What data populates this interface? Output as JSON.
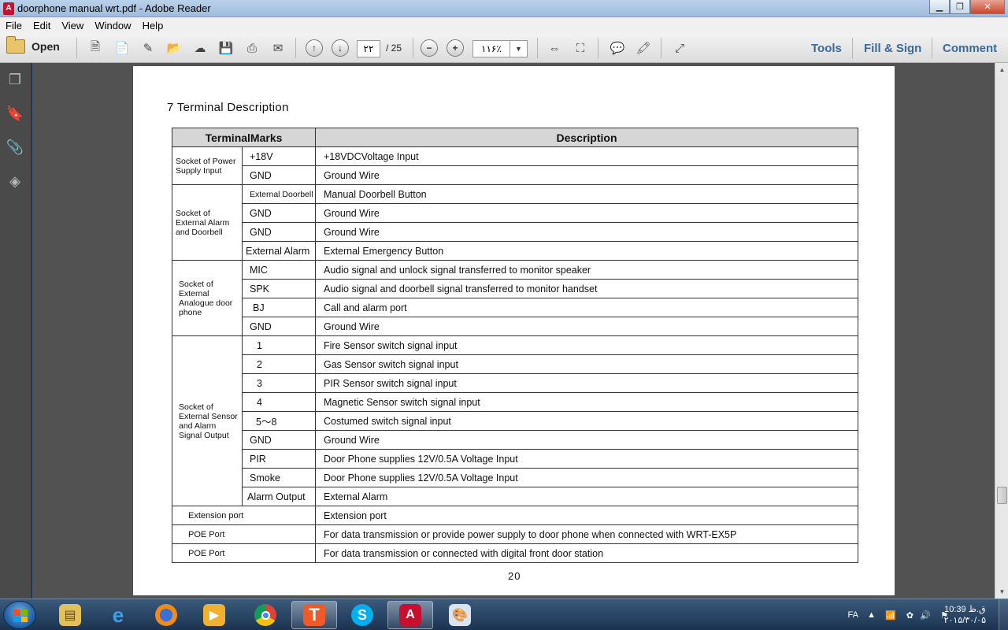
{
  "window": {
    "title": "doorphone manual wrt.pdf - Adobe Reader",
    "app_icon_glyph": "A"
  },
  "menu": [
    "File",
    "Edit",
    "View",
    "Window",
    "Help"
  ],
  "toolbar": {
    "open_label": "Open",
    "page_current": "۲۲",
    "page_total": "/ 25",
    "zoom": "۱۱۶٪",
    "tools_label": "Tools",
    "fill_sign_label": "Fill & Sign",
    "comment_label": "Comment"
  },
  "document": {
    "heading": "7 Terminal Description",
    "page_number": "20",
    "table": {
      "headers": [
        "TerminalMarks",
        "Description"
      ],
      "rows": [
        {
          "group": "Socket of Power Supply Input",
          "mark": "+18V",
          "desc": "+18VDCVoltage Input"
        },
        {
          "mark": "GND",
          "desc": "Ground Wire"
        },
        {
          "group": "Socket of External Alarm and Doorbell",
          "mark": "External Doorbell",
          "desc": "Manual Doorbell Button"
        },
        {
          "mark": "GND",
          "desc": "Ground Wire"
        },
        {
          "mark": "GND",
          "desc": "Ground Wire"
        },
        {
          "mark": "External Alarm",
          "desc": "External Emergency Button"
        },
        {
          "group": "Socket of External Analogue door phone",
          "mark": "MIC",
          "desc": "Audio signal and unlock signal transferred to monitor speaker"
        },
        {
          "mark": "SPK",
          "desc": "Audio signal and doorbell signal transferred to monitor handset"
        },
        {
          "mark": "BJ",
          "desc": "Call and alarm port"
        },
        {
          "mark": "GND",
          "desc": "Ground Wire"
        },
        {
          "group": "Socket of External Sensor and Alarm Signal Output",
          "mark": "1",
          "desc": "Fire Sensor switch signal input"
        },
        {
          "mark": "2",
          "desc": "Gas Sensor switch signal input"
        },
        {
          "mark": "3",
          "desc": "PIR Sensor switch signal input"
        },
        {
          "mark": "4",
          "desc": "Magnetic Sensor switch signal input"
        },
        {
          "mark": "5～8",
          "desc": "Costumed switch signal input"
        },
        {
          "mark": "GND",
          "desc": "Ground Wire"
        },
        {
          "mark": "PIR",
          "desc": "Door Phone supplies 12V/0.5A Voltage Input"
        },
        {
          "mark": "Smoke",
          "desc": "Door Phone supplies 12V/0.5A Voltage Input"
        },
        {
          "mark": "Alarm Output",
          "desc": "External Alarm"
        },
        {
          "full": "Extension port",
          "desc": "Extension port"
        },
        {
          "full": "POE Port",
          "desc": "For data transmission or provide power supply to door phone when connected with WRT-EX5P"
        },
        {
          "full": "POE Port",
          "desc": "For data transmission or connected with digital front door station"
        }
      ]
    }
  },
  "taskbar": {
    "language": "FA",
    "time": "10:39 ق.ظ",
    "date": "۲۰۱۵/۳۰/۰۵"
  }
}
